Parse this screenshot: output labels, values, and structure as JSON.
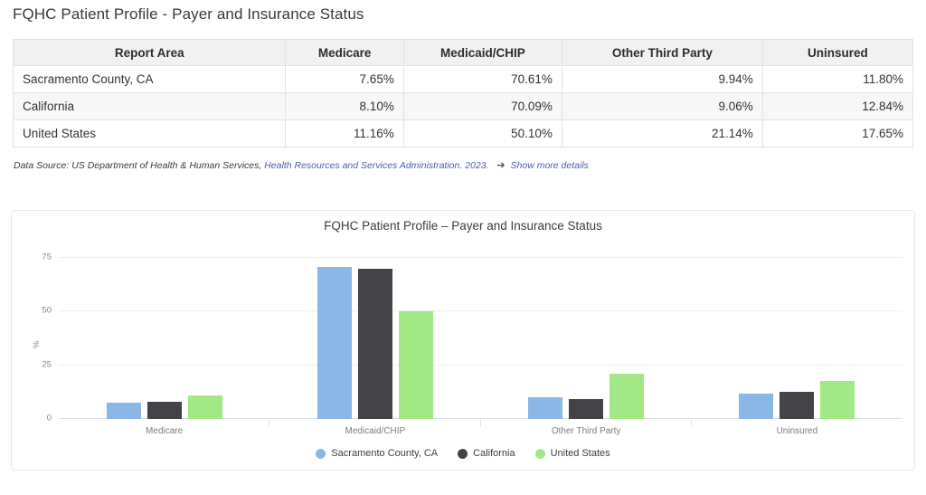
{
  "page_title": "FQHC Patient Profile - Payer and Insurance Status",
  "table": {
    "headers": [
      "Report Area",
      "Medicare",
      "Medicaid/CHIP",
      "Other Third Party",
      "Uninsured"
    ],
    "rows": [
      {
        "area": "Sacramento County, CA",
        "medicare": "7.65%",
        "medicaid": "70.61%",
        "other": "9.94%",
        "uninsured": "11.80%"
      },
      {
        "area": "California",
        "medicare": "8.10%",
        "medicaid": "70.09%",
        "other": "9.06%",
        "uninsured": "12.84%"
      },
      {
        "area": "United States",
        "medicare": "11.16%",
        "medicaid": "50.10%",
        "other": "21.14%",
        "uninsured": "17.65%"
      }
    ]
  },
  "source_note": {
    "prefix": "Data Source: US Department of Health & Human Services,",
    "link": "Health Resources and Services Administration. 2023.",
    "arrow": "➔",
    "more": "Show more details"
  },
  "chart_data": {
    "type": "bar",
    "title": "FQHC Patient Profile – Payer and Insurance Status",
    "xlabel": "",
    "ylabel": "%",
    "categories": [
      "Medicare",
      "Medicaid/CHIP",
      "Other Third Party",
      "Uninsured"
    ],
    "ylim": [
      0,
      80
    ],
    "yticks": [
      0,
      25,
      50,
      75
    ],
    "ytick_labels": [
      "0",
      "25",
      "50",
      "75"
    ],
    "grid": true,
    "legend_position": "bottom",
    "series": [
      {
        "name": "Sacramento County, CA",
        "color": "#8bb6e8",
        "values": [
          7.65,
          70.61,
          9.94,
          11.8
        ]
      },
      {
        "name": "California",
        "color": "#434348",
        "values": [
          8.1,
          70.09,
          9.06,
          12.84
        ]
      },
      {
        "name": "United States",
        "color": "#a3e887",
        "values": [
          11.16,
          50.1,
          21.14,
          17.65
        ]
      }
    ]
  }
}
